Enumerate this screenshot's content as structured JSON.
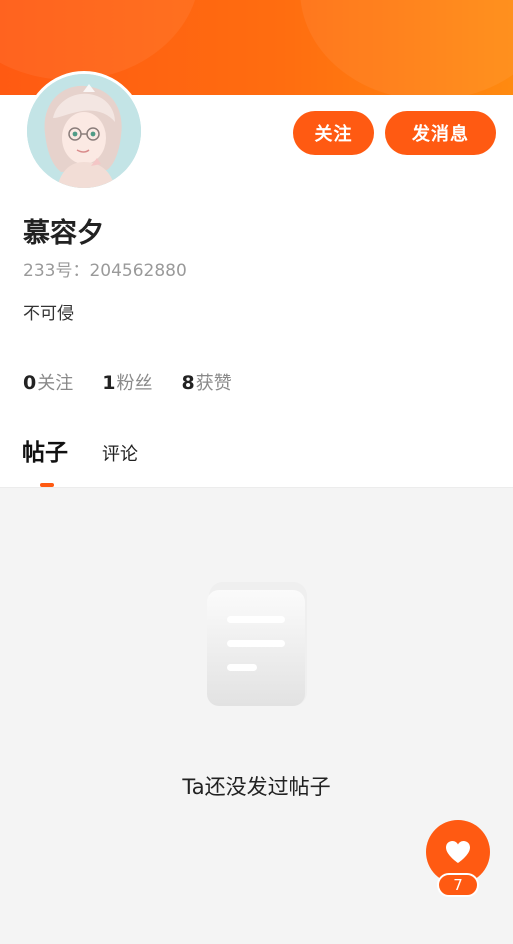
{
  "colors": {
    "accent": "#ff5a12",
    "header_gradient_start": "#ff5a12",
    "header_gradient_end": "#ff8a10",
    "muted_text": "#9a9a9a",
    "background": "#f4f4f4"
  },
  "profile": {
    "name": "慕容夕",
    "id_line": "233号：204562880",
    "bio": "不可侵",
    "avatar_icon": "anime-girl-avatar"
  },
  "actions": {
    "follow_label": "关注",
    "message_label": "发消息"
  },
  "stats": [
    {
      "value": "0",
      "label": "关注"
    },
    {
      "value": "1",
      "label": "粉丝"
    },
    {
      "value": "8",
      "label": "获赞"
    }
  ],
  "tabs": [
    {
      "label": "帖子",
      "active": true
    },
    {
      "label": "评论",
      "active": false
    }
  ],
  "empty_state": {
    "icon": "document-icon",
    "message": "Ta还没发过帖子"
  },
  "like_button": {
    "icon": "heart-icon",
    "count": "7"
  }
}
